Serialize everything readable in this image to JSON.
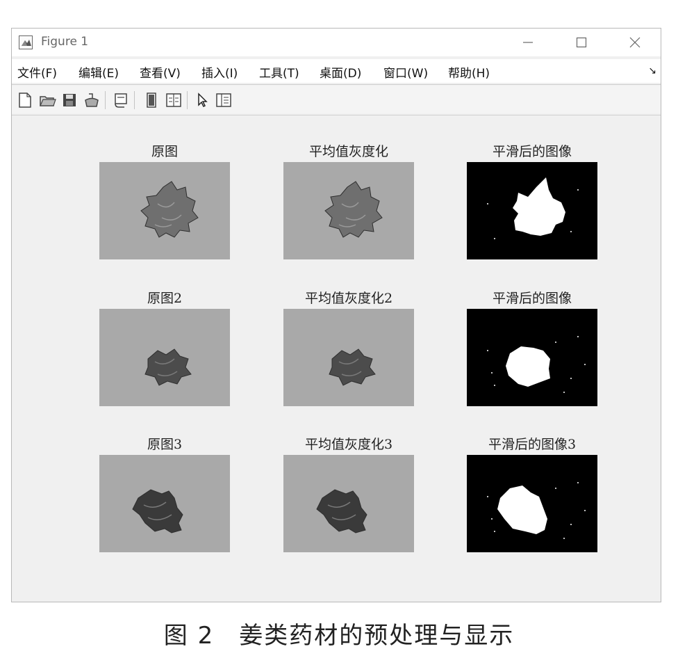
{
  "window": {
    "title": "Figure 1",
    "controls": {
      "minimize": "minimize-icon",
      "maximize": "maximize-icon",
      "close": "close-icon"
    }
  },
  "menu": {
    "items": [
      "文件(F)",
      "编辑(E)",
      "查看(V)",
      "插入(I)",
      "工具(T)",
      "桌面(D)",
      "窗口(W)",
      "帮助(H)"
    ],
    "overflow_arrow": "↘"
  },
  "toolbar": {
    "icons": [
      "new-figure-icon",
      "open-file-icon",
      "save-icon",
      "print-icon",
      "link-plot-icon",
      "hide-plot-tools-icon",
      "show-plot-tools-icon",
      "edit-plot-pointer-icon",
      "property-editor-icon"
    ]
  },
  "figure": {
    "panels": [
      {
        "title": "原图",
        "kind": "original",
        "row": 1
      },
      {
        "title": "平均值灰度化",
        "kind": "gray",
        "row": 1
      },
      {
        "title": "平滑后的图像",
        "kind": "binary",
        "row": 1
      },
      {
        "title": "原图2",
        "kind": "original",
        "row": 2
      },
      {
        "title": "平均值灰度化2",
        "kind": "gray",
        "row": 2
      },
      {
        "title": "平滑后的图像",
        "kind": "binary",
        "row": 2
      },
      {
        "title": "原图3",
        "kind": "original",
        "row": 3
      },
      {
        "title": "平均值灰度化3",
        "kind": "gray",
        "row": 3
      },
      {
        "title": "平滑后的图像3",
        "kind": "binary",
        "row": 3
      }
    ],
    "colors": {
      "background_gray": "#a9a9a9",
      "object_light": "#6f6f6f",
      "object_dark": "#3a3a3a",
      "binary_bg": "#000000",
      "binary_fg": "#ffffff"
    }
  },
  "caption": "图 2　姜类药材的预处理与显示"
}
